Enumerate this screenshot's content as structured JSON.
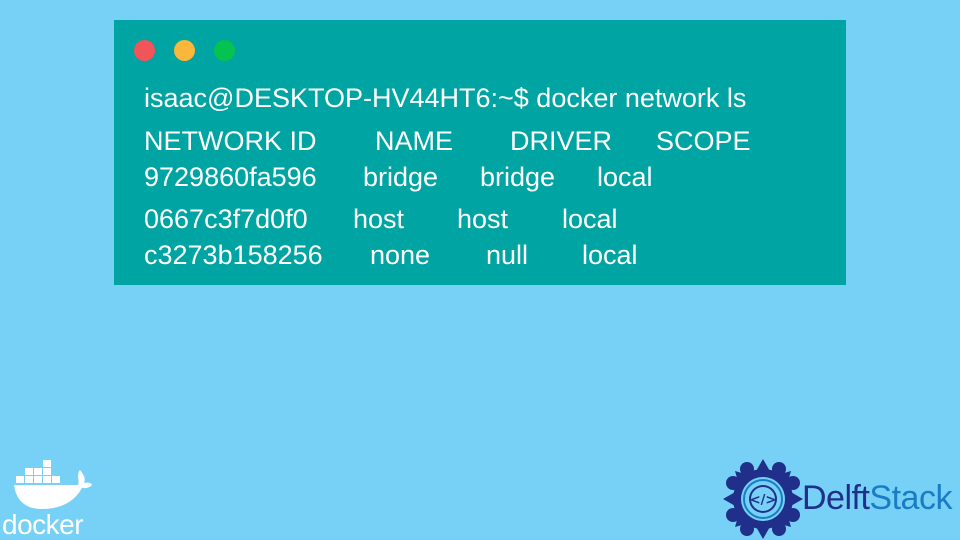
{
  "terminal": {
    "window_controls": [
      "close",
      "minimize",
      "maximize"
    ],
    "prompt_line": "isaac@DESKTOP-HV44HT6:~$ docker network ls",
    "table": {
      "columns": [
        "NETWORK ID",
        "NAME",
        "DRIVER",
        "SCOPE"
      ],
      "rows": [
        [
          "9729860fa596",
          "bridge",
          "bridge",
          "local"
        ],
        [
          "0667c3f7d0f0",
          "host",
          "host",
          "local"
        ],
        [
          "c3273b158256",
          "none",
          "null",
          "local"
        ]
      ]
    }
  },
  "branding": {
    "docker_text": "docker",
    "delft_part1": "Delft",
    "delft_part2": "Stack"
  },
  "colors": {
    "background": "#77d1f7",
    "terminal": "#00a4a3",
    "dot_red": "#f1555a",
    "dot_yellow": "#fbb73c",
    "dot_green": "#06c250",
    "delft_dark": "#1f2f8a",
    "delft_light": "#1a7cc4"
  }
}
